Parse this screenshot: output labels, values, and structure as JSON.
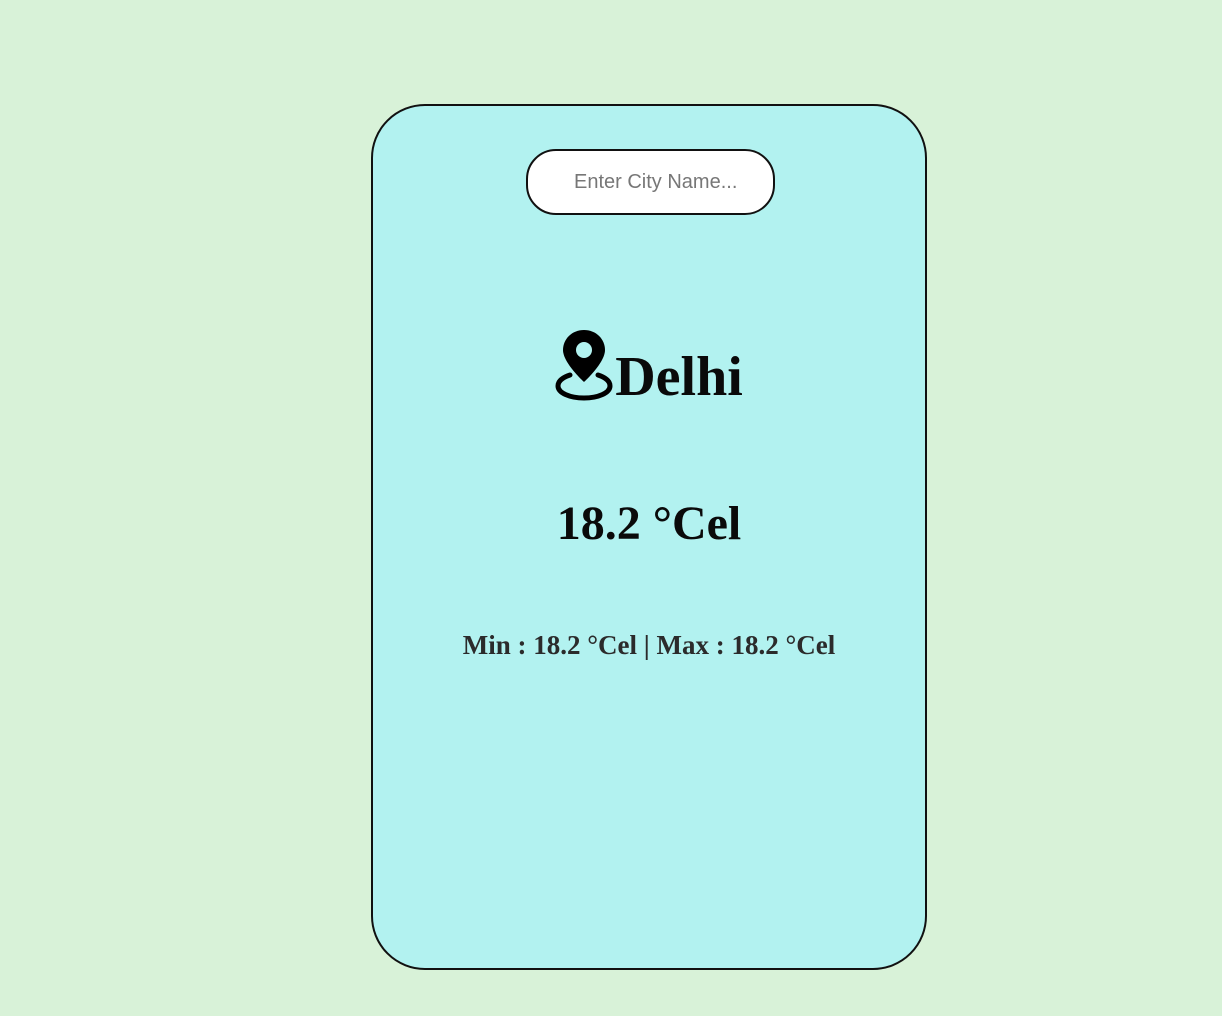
{
  "search": {
    "placeholder": "Enter City Name...",
    "value": ""
  },
  "location": {
    "icon": "location-pin-icon",
    "city": "Delhi"
  },
  "weather": {
    "temperature": "18.2 °Cel",
    "min_max": "Min : 18.2 °Cel | Max : 18.2 °Cel"
  },
  "colors": {
    "page_background": "#d8f2d8",
    "card_background": "#b2f2f0",
    "border": "#111111"
  }
}
